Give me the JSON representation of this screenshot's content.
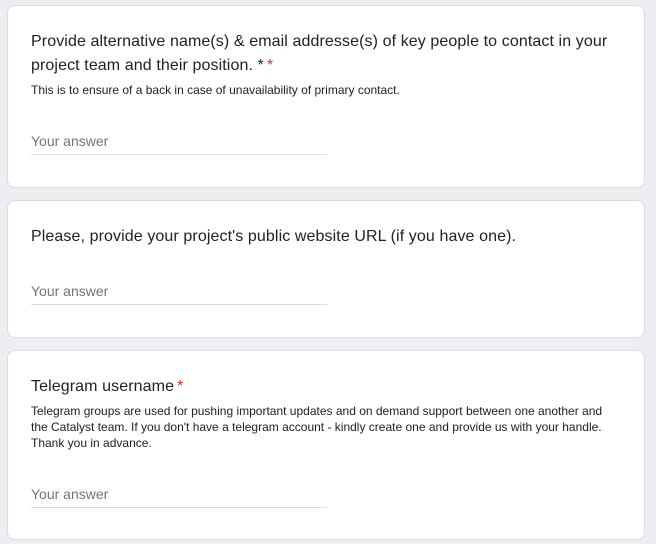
{
  "questions": [
    {
      "title": "Provide alternative name(s) & email addresse(s) of key people to contact in your project team and their position. *",
      "required_mark": "*",
      "description": "This is to ensure of a back in case of unavailability of primary contact.",
      "answer_placeholder": "Your answer",
      "answer_value": ""
    },
    {
      "title": "Please, provide your project's public website URL (if you have one).",
      "answer_placeholder": "Your answer",
      "answer_value": ""
    },
    {
      "title": "Telegram username",
      "required_mark": "*",
      "description": "Telegram groups are used for pushing important updates and on demand support between one another and the Catalyst team. If you don't have a telegram account - kindly create one and provide us with your handle. Thank you in advance.",
      "answer_placeholder": "Your answer",
      "answer_value": ""
    }
  ],
  "colors": {
    "page_background": "#eceef1",
    "card_background": "#ffffff",
    "required_asterisk": "#d93025",
    "text": "#202124",
    "placeholder": "#70757a"
  }
}
